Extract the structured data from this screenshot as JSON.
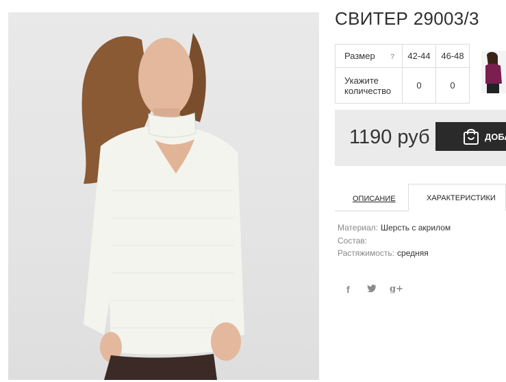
{
  "product": {
    "title": "СВИТЕР 29003/3"
  },
  "size_table": {
    "size_label": "Размер",
    "help": "?",
    "sizes": [
      "42-44",
      "46-48"
    ],
    "qty_label_line1": "Укажите",
    "qty_label_line2": "количество",
    "quantities": [
      "0",
      "0"
    ]
  },
  "price": {
    "value": "1190 руб"
  },
  "buy_button": {
    "label": "ДОБА"
  },
  "tabs": {
    "description": "ОПИСАНИЕ",
    "characteristics": "ХАРАКТЕРИСТИКИ"
  },
  "specs": [
    {
      "key": "Материал:",
      "value": "Шерсть с акрилом"
    },
    {
      "key": "Состав:",
      "value": ""
    },
    {
      "key": "Растяжимость:",
      "value": "средняя"
    }
  ],
  "social": {
    "facebook": "f",
    "twitter": "t",
    "googleplus": "g+"
  },
  "colors": {
    "accent_dark": "#2a2a2a",
    "price_bg": "#ebebeb",
    "border": "#dcdcdc",
    "thumb_color": "#7a1f4f"
  }
}
